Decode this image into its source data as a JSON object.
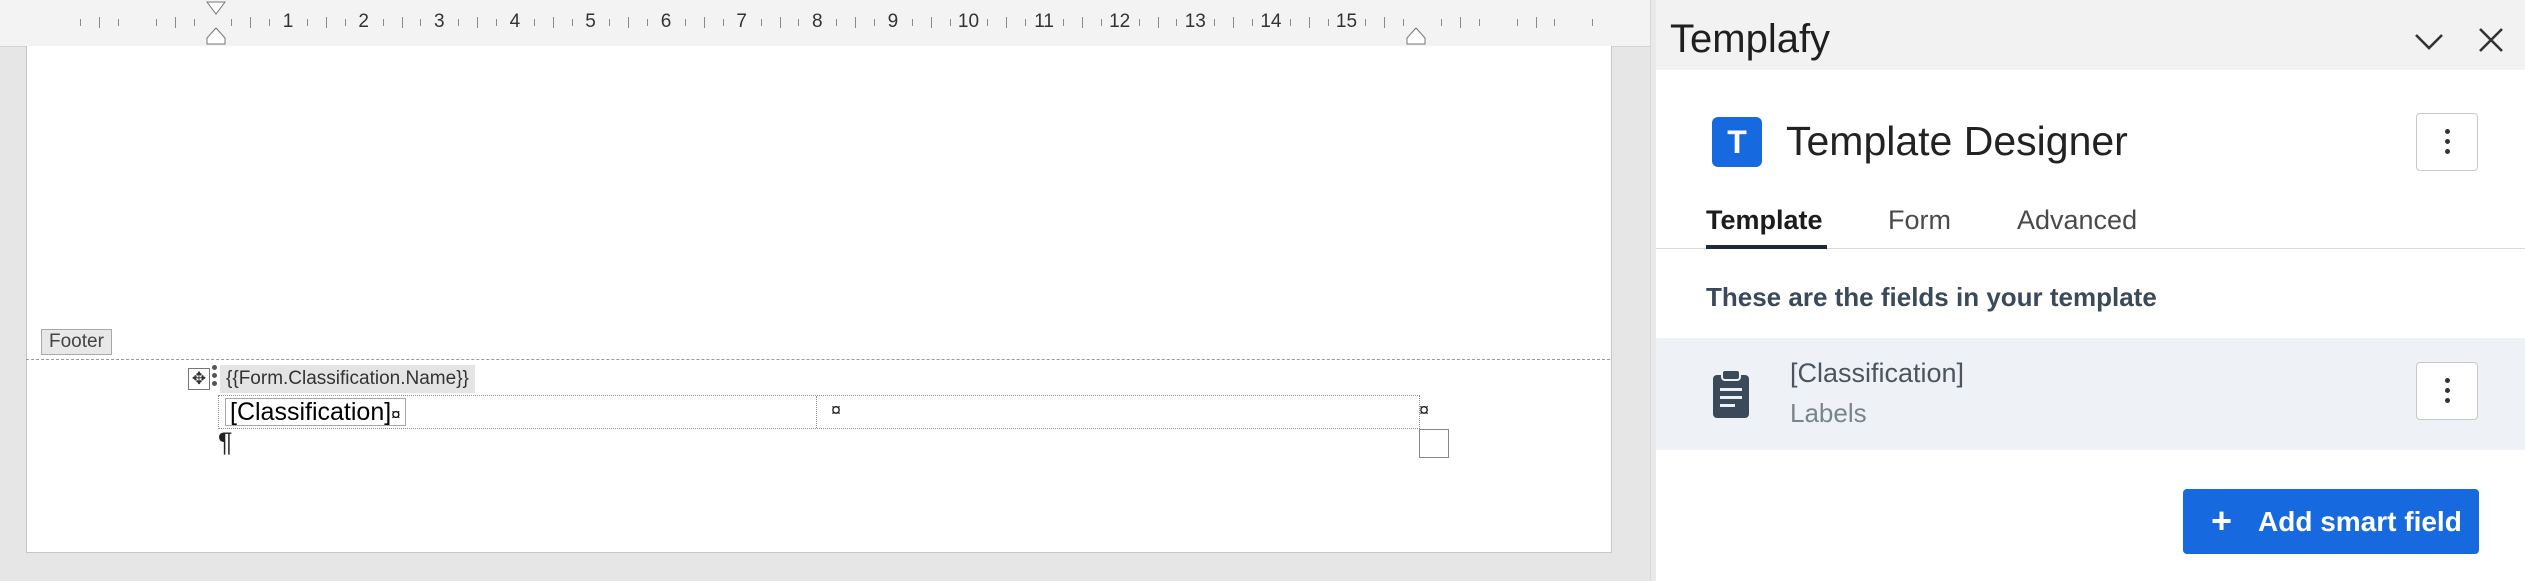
{
  "ruler": {
    "numbers": [
      "1",
      "2",
      "3",
      "4",
      "5",
      "6",
      "7",
      "8",
      "9",
      "10",
      "11",
      "12",
      "13",
      "14",
      "15"
    ]
  },
  "document": {
    "footer_label": "Footer",
    "content_control_tag": "{{Form.Classification.Name}}",
    "classification_placeholder": "[Classification]",
    "cell_end_mark": "¤",
    "paragraph_mark": "¶"
  },
  "pane": {
    "title": "Templafy",
    "header_icons": [
      "chevron-down-icon",
      "close-icon"
    ],
    "app_logo_letter": "T",
    "app_title": "Template Designer",
    "tabs": [
      "Template",
      "Form",
      "Advanced"
    ],
    "active_tab": "Template",
    "fields_heading": "These are the fields in your template",
    "fields": [
      {
        "name": "[Classification]",
        "type": "Labels",
        "icon": "clipboard-icon"
      }
    ],
    "add_button_label": "Add smart field",
    "accent_color": "#1769e0"
  }
}
